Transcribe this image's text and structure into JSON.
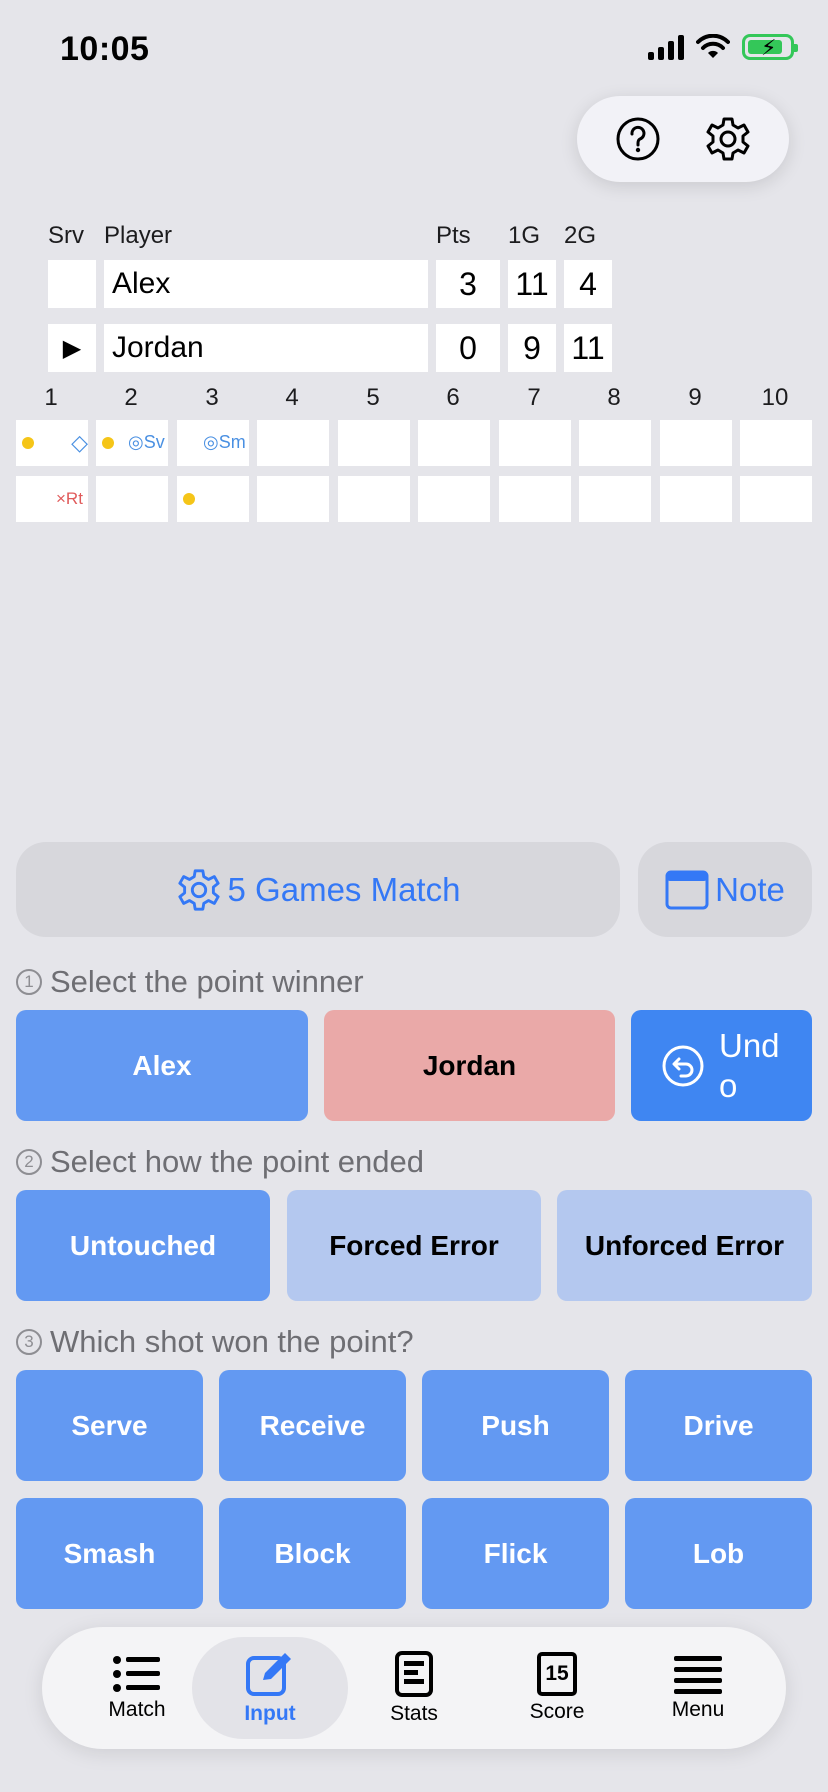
{
  "status": {
    "time": "10:05"
  },
  "scoreboard": {
    "headers": {
      "srv": "Srv",
      "player": "Player",
      "pts": "Pts",
      "g1": "1G",
      "g2": "2G"
    },
    "players": [
      {
        "name": "Alex",
        "serving_marker": "",
        "pts": "3",
        "g1": "11",
        "g2": "4"
      },
      {
        "name": "Jordan",
        "serving_marker": "▶",
        "pts": "0",
        "g1": "9",
        "g2": "11"
      }
    ]
  },
  "rally": {
    "columns": [
      "1",
      "2",
      "3",
      "4",
      "5",
      "6",
      "7",
      "8",
      "9",
      "10"
    ],
    "marks": {
      "diamond": "◇",
      "serve": "◎Sv",
      "smash": "◎Sm",
      "return_error": "×Rt"
    }
  },
  "match": {
    "label": "5 Games Match",
    "note_label": "Note"
  },
  "step1": {
    "num": "1",
    "label": "Select the point winner",
    "player1": "Alex",
    "player2": "Jordan",
    "undo": "Undo"
  },
  "step2": {
    "num": "2",
    "label": "Select how the point ended",
    "options": [
      "Untouched",
      "Forced Error",
      "Unforced Error"
    ]
  },
  "step3": {
    "num": "3",
    "label": "Which shot won the point?",
    "shots": [
      "Serve",
      "Receive",
      "Push",
      "Drive",
      "Smash",
      "Block",
      "Flick",
      "Lob"
    ]
  },
  "tabs": [
    {
      "label": "Match",
      "icon": "list-icon"
    },
    {
      "label": "Input",
      "icon": "edit-icon",
      "active": true
    },
    {
      "label": "Stats",
      "icon": "document-icon"
    },
    {
      "label": "Score",
      "icon": "scoreboard-icon",
      "badge": "15"
    },
    {
      "label": "Menu",
      "icon": "menu-icon"
    }
  ],
  "colors": {
    "accent": "#3478f6",
    "player1": "#6399f2",
    "player2": "#eaa9a8",
    "point_dot": "#f5c518"
  }
}
